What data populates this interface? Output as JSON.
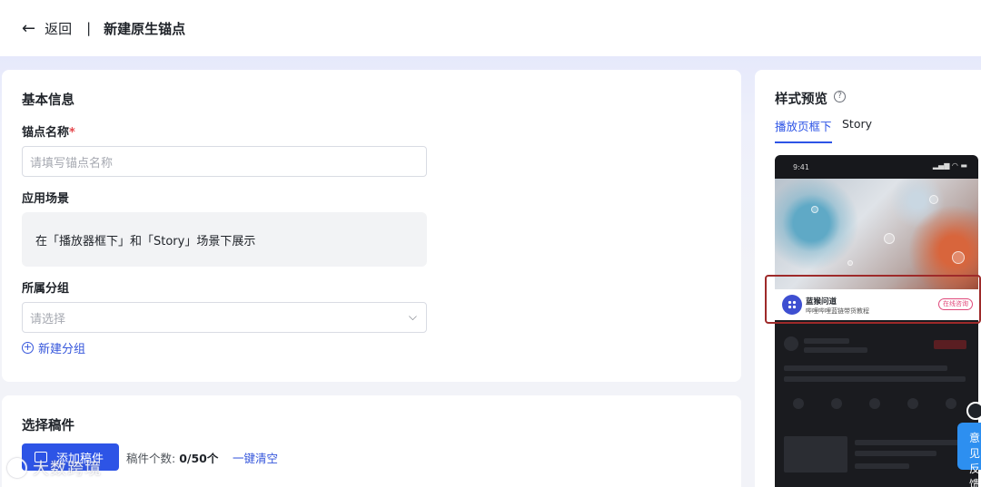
{
  "header": {
    "back_label": "返回",
    "separator": "|",
    "title": "新建原生锚点"
  },
  "basic_info": {
    "section_title": "基本信息",
    "anchor_name_label": "锚点名称",
    "required_mark": "*",
    "anchor_name_placeholder": "请填写锚点名称",
    "scene_label": "应用场景",
    "scene_text": "在「播放器框下」和「Story」场景下展示",
    "group_label": "所属分组",
    "group_placeholder": "请选择",
    "new_group_link": "新建分组"
  },
  "select_manuscript": {
    "section_title": "选择稿件",
    "add_button": "添加稿件",
    "count_label": "稿件个数:",
    "count_value": "0/50个",
    "clear_link": "一键清空"
  },
  "preview": {
    "title": "样式预览",
    "tabs": [
      {
        "label": "播放页框下",
        "active": true
      },
      {
        "label": "Story",
        "active": false
      }
    ],
    "phone": {
      "time": "9:41",
      "anchor_name": "蓝猴问道",
      "anchor_desc": "哔哩哔哩蓝链带货教程",
      "anchor_cta": "在线咨询"
    }
  },
  "floating": {
    "feedback_label": "意见反馈"
  },
  "watermark": "大数跨境",
  "colors": {
    "primary": "#2d54e6",
    "link": "#3455db",
    "highlight": "#9e2a2a",
    "cta": "#e0487a"
  }
}
